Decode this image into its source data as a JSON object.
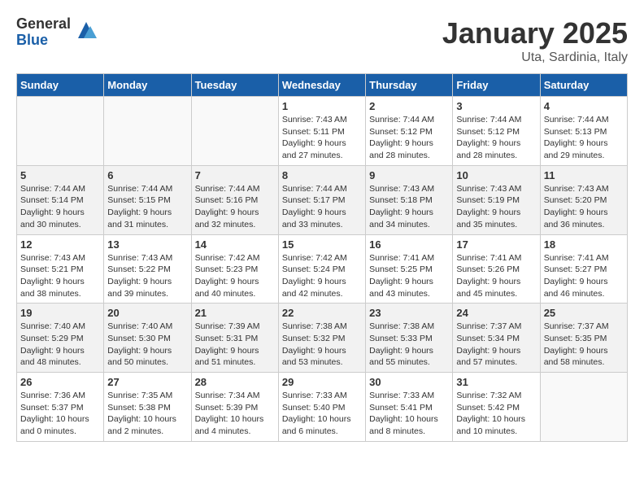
{
  "logo": {
    "general": "General",
    "blue": "Blue"
  },
  "title": "January 2025",
  "location": "Uta, Sardinia, Italy",
  "weekdays": [
    "Sunday",
    "Monday",
    "Tuesday",
    "Wednesday",
    "Thursday",
    "Friday",
    "Saturday"
  ],
  "weeks": [
    {
      "shade": false,
      "days": [
        {
          "num": "",
          "info": ""
        },
        {
          "num": "",
          "info": ""
        },
        {
          "num": "",
          "info": ""
        },
        {
          "num": "1",
          "info": "Sunrise: 7:43 AM\nSunset: 5:11 PM\nDaylight: 9 hours and 27 minutes."
        },
        {
          "num": "2",
          "info": "Sunrise: 7:44 AM\nSunset: 5:12 PM\nDaylight: 9 hours and 28 minutes."
        },
        {
          "num": "3",
          "info": "Sunrise: 7:44 AM\nSunset: 5:12 PM\nDaylight: 9 hours and 28 minutes."
        },
        {
          "num": "4",
          "info": "Sunrise: 7:44 AM\nSunset: 5:13 PM\nDaylight: 9 hours and 29 minutes."
        }
      ]
    },
    {
      "shade": true,
      "days": [
        {
          "num": "5",
          "info": "Sunrise: 7:44 AM\nSunset: 5:14 PM\nDaylight: 9 hours and 30 minutes."
        },
        {
          "num": "6",
          "info": "Sunrise: 7:44 AM\nSunset: 5:15 PM\nDaylight: 9 hours and 31 minutes."
        },
        {
          "num": "7",
          "info": "Sunrise: 7:44 AM\nSunset: 5:16 PM\nDaylight: 9 hours and 32 minutes."
        },
        {
          "num": "8",
          "info": "Sunrise: 7:44 AM\nSunset: 5:17 PM\nDaylight: 9 hours and 33 minutes."
        },
        {
          "num": "9",
          "info": "Sunrise: 7:43 AM\nSunset: 5:18 PM\nDaylight: 9 hours and 34 minutes."
        },
        {
          "num": "10",
          "info": "Sunrise: 7:43 AM\nSunset: 5:19 PM\nDaylight: 9 hours and 35 minutes."
        },
        {
          "num": "11",
          "info": "Sunrise: 7:43 AM\nSunset: 5:20 PM\nDaylight: 9 hours and 36 minutes."
        }
      ]
    },
    {
      "shade": false,
      "days": [
        {
          "num": "12",
          "info": "Sunrise: 7:43 AM\nSunset: 5:21 PM\nDaylight: 9 hours and 38 minutes."
        },
        {
          "num": "13",
          "info": "Sunrise: 7:43 AM\nSunset: 5:22 PM\nDaylight: 9 hours and 39 minutes."
        },
        {
          "num": "14",
          "info": "Sunrise: 7:42 AM\nSunset: 5:23 PM\nDaylight: 9 hours and 40 minutes."
        },
        {
          "num": "15",
          "info": "Sunrise: 7:42 AM\nSunset: 5:24 PM\nDaylight: 9 hours and 42 minutes."
        },
        {
          "num": "16",
          "info": "Sunrise: 7:41 AM\nSunset: 5:25 PM\nDaylight: 9 hours and 43 minutes."
        },
        {
          "num": "17",
          "info": "Sunrise: 7:41 AM\nSunset: 5:26 PM\nDaylight: 9 hours and 45 minutes."
        },
        {
          "num": "18",
          "info": "Sunrise: 7:41 AM\nSunset: 5:27 PM\nDaylight: 9 hours and 46 minutes."
        }
      ]
    },
    {
      "shade": true,
      "days": [
        {
          "num": "19",
          "info": "Sunrise: 7:40 AM\nSunset: 5:29 PM\nDaylight: 9 hours and 48 minutes."
        },
        {
          "num": "20",
          "info": "Sunrise: 7:40 AM\nSunset: 5:30 PM\nDaylight: 9 hours and 50 minutes."
        },
        {
          "num": "21",
          "info": "Sunrise: 7:39 AM\nSunset: 5:31 PM\nDaylight: 9 hours and 51 minutes."
        },
        {
          "num": "22",
          "info": "Sunrise: 7:38 AM\nSunset: 5:32 PM\nDaylight: 9 hours and 53 minutes."
        },
        {
          "num": "23",
          "info": "Sunrise: 7:38 AM\nSunset: 5:33 PM\nDaylight: 9 hours and 55 minutes."
        },
        {
          "num": "24",
          "info": "Sunrise: 7:37 AM\nSunset: 5:34 PM\nDaylight: 9 hours and 57 minutes."
        },
        {
          "num": "25",
          "info": "Sunrise: 7:37 AM\nSunset: 5:35 PM\nDaylight: 9 hours and 58 minutes."
        }
      ]
    },
    {
      "shade": false,
      "days": [
        {
          "num": "26",
          "info": "Sunrise: 7:36 AM\nSunset: 5:37 PM\nDaylight: 10 hours and 0 minutes."
        },
        {
          "num": "27",
          "info": "Sunrise: 7:35 AM\nSunset: 5:38 PM\nDaylight: 10 hours and 2 minutes."
        },
        {
          "num": "28",
          "info": "Sunrise: 7:34 AM\nSunset: 5:39 PM\nDaylight: 10 hours and 4 minutes."
        },
        {
          "num": "29",
          "info": "Sunrise: 7:33 AM\nSunset: 5:40 PM\nDaylight: 10 hours and 6 minutes."
        },
        {
          "num": "30",
          "info": "Sunrise: 7:33 AM\nSunset: 5:41 PM\nDaylight: 10 hours and 8 minutes."
        },
        {
          "num": "31",
          "info": "Sunrise: 7:32 AM\nSunset: 5:42 PM\nDaylight: 10 hours and 10 minutes."
        },
        {
          "num": "",
          "info": ""
        }
      ]
    }
  ]
}
